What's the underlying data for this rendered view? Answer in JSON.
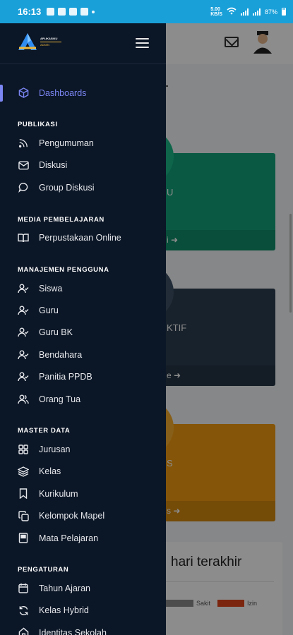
{
  "statusbar": {
    "time": "16:13",
    "battery": "87%",
    "network_speed": "5.00\nKB/S"
  },
  "page": {
    "card1_label": "U",
    "card2_label": "KTIF",
    "card3_label": "S",
    "card1_footer": "i",
    "card2_footer": "e",
    "card3_footer": "s",
    "bottom_title": "hari terakhir",
    "legend": [
      {
        "label": "Sakit",
        "color": "#8a8a8a"
      },
      {
        "label": "Izin",
        "color": "#e0421b"
      }
    ],
    "colors": {
      "card1": "#13a37a",
      "card2": "#2c3e50",
      "card3": "#f39c12"
    }
  },
  "drawer": {
    "logo_line1": "APLIKASIKU",
    "logo_line2": "ADMIN",
    "dashboard": "Dashboards",
    "sections": {
      "publikasi": "PUBLIKASI",
      "media": "MEDIA PEMBELAJARAN",
      "manajemen": "MANAJEMEN PENGGUNA",
      "master": "MASTER DATA",
      "pengaturan": "PENGATURAN"
    },
    "publikasi_items": [
      "Pengumuman",
      "Diskusi",
      "Group Diskusi"
    ],
    "media_items": [
      "Perpustakaan Online"
    ],
    "manajemen_items": [
      "Siswa",
      "Guru",
      "Guru BK",
      "Bendahara",
      "Panitia PPDB",
      "Orang Tua"
    ],
    "master_items": [
      "Jurusan",
      "Kelas",
      "Kurikulum",
      "Kelompok Mapel",
      "Mata Pelajaran"
    ],
    "pengaturan_items": [
      "Tahun Ajaran",
      "Kelas Hybrid",
      "Identitas Sekolah"
    ],
    "accent_color": "#7b86f3"
  }
}
